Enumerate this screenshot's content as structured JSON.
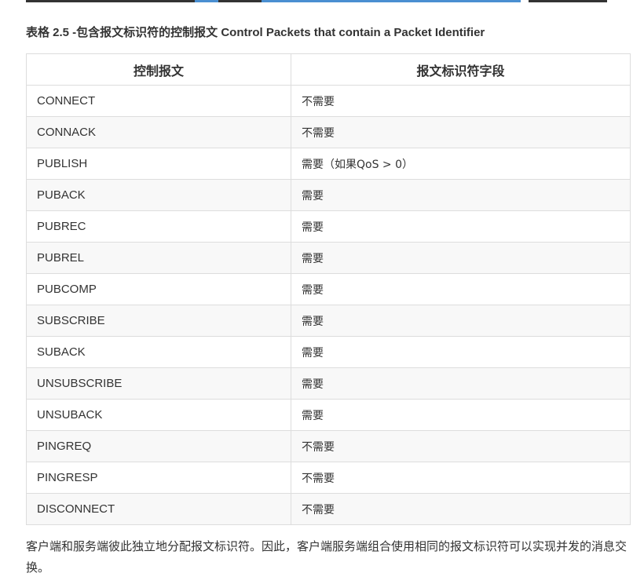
{
  "caption": "表格 2.5 -包含报文标识符的控制报文 Control Packets that contain a Packet Identifier",
  "table": {
    "headers": [
      "控制报文",
      "报文标识符字段"
    ],
    "rows": [
      [
        "CONNECT",
        "不需要"
      ],
      [
        "CONNACK",
        "不需要"
      ],
      [
        "PUBLISH",
        "需要（如果QoS > 0）"
      ],
      [
        "PUBACK",
        "需要"
      ],
      [
        "PUBREC",
        "需要"
      ],
      [
        "PUBREL",
        "需要"
      ],
      [
        "PUBCOMP",
        "需要"
      ],
      [
        "SUBSCRIBE",
        "需要"
      ],
      [
        "SUBACK",
        "需要"
      ],
      [
        "UNSUBSCRIBE",
        "需要"
      ],
      [
        "UNSUBACK",
        "需要"
      ],
      [
        "PINGREQ",
        "不需要"
      ],
      [
        "PINGRESP",
        "不需要"
      ],
      [
        "DISCONNECT",
        "不需要"
      ]
    ]
  },
  "paragraph": "客户端和服务端彼此独立地分配报文标识符。因此，客户端服务端组合使用相同的报文标识符可以实现并发的消息交换。",
  "colors": {
    "link": "#4a8fd1",
    "border": "#dddddd",
    "stripe": "#f8f8f8",
    "text": "#333333"
  }
}
